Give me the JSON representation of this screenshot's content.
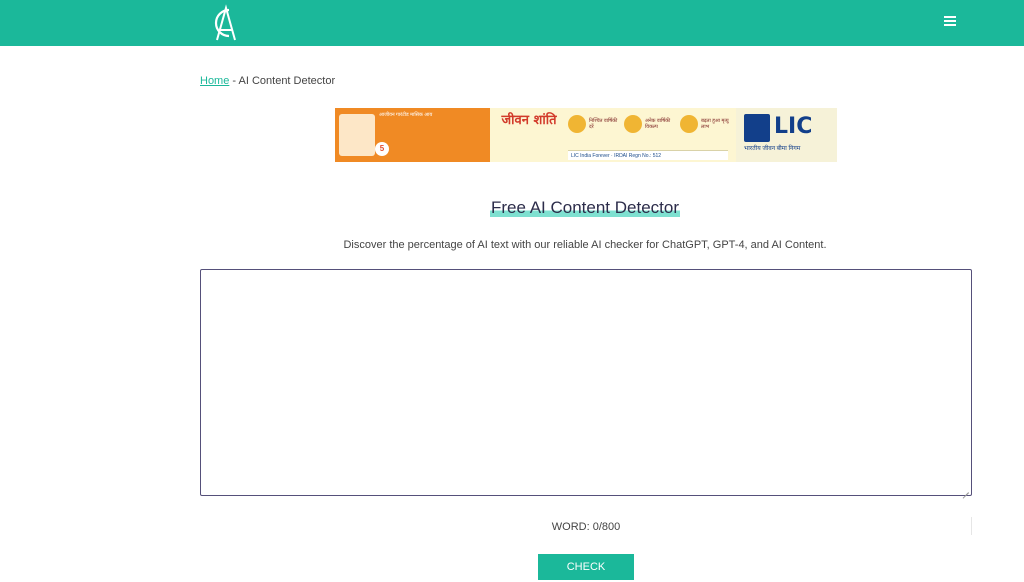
{
  "colors": {
    "brand": "#1bb89a"
  },
  "header": {
    "logo_text": "CA",
    "menu_icon": "hamburger-menu-icon"
  },
  "breadcrumb": {
    "home": "Home",
    "separator": " - ",
    "current": "AI Content Detector"
  },
  "ad": {
    "left_headline": "आजीवन गारंटीड मासिक आय",
    "left_badge": "5",
    "mid_brand": "जीवन शांति",
    "pills": [
      "निश्चित वार्षिकी दरें",
      "अनेक वार्षिकी विकल्प",
      "बढ़ता हुआ मृत्यु लाभ"
    ],
    "footline": "LIC India Forever · IRDAI Regn No.: 512",
    "right_logo_text": "LIC",
    "right_sub": "भारतीय जीवन बीमा निगम"
  },
  "main": {
    "title": "Free AI Content Detector",
    "subtitle": "Discover the percentage of AI text with our reliable AI checker for ChatGPT, GPT-4, and AI Content.",
    "textarea_value": "",
    "word_count": "WORD: 0/800",
    "check_label": "CHECK"
  }
}
